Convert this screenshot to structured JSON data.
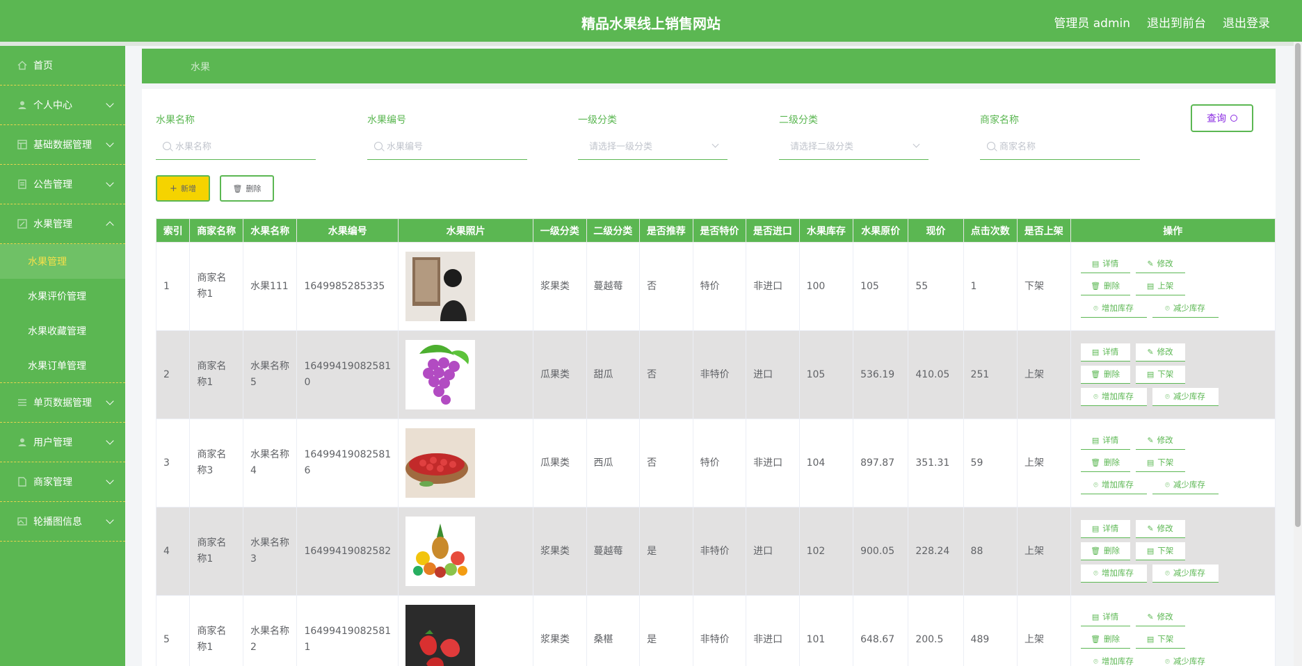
{
  "header": {
    "title": "精品水果线上销售网站",
    "admin_label": "管理员 admin",
    "to_front": "退出到前台",
    "logout": "退出登录"
  },
  "sidebar": {
    "items": [
      {
        "label": "首页",
        "icon": "home-icon"
      },
      {
        "label": "个人中心",
        "icon": "user-icon"
      },
      {
        "label": "基础数据管理",
        "icon": "grid-icon"
      },
      {
        "label": "公告管理",
        "icon": "notice-icon"
      },
      {
        "label": "水果管理",
        "icon": "fruit-icon"
      },
      {
        "label": "单页数据管理",
        "icon": "list-icon"
      },
      {
        "label": "用户管理",
        "icon": "user-icon"
      },
      {
        "label": "商家管理",
        "icon": "shop-icon"
      },
      {
        "label": "轮播图信息",
        "icon": "image-icon"
      }
    ],
    "sub_items": [
      "水果管理",
      "水果评价管理",
      "水果收藏管理",
      "水果订单管理"
    ]
  },
  "breadcrumb": "水果",
  "filters": {
    "name_label": "水果名称",
    "name_placeholder": "水果名称",
    "code_label": "水果编号",
    "code_placeholder": "水果编号",
    "cat1_label": "一级分类",
    "cat1_placeholder": "请选择一级分类",
    "cat2_label": "二级分类",
    "cat2_placeholder": "请选择二级分类",
    "shop_label": "商家名称",
    "shop_placeholder": "商家名称",
    "query_button": "查询"
  },
  "actions": {
    "add": "新增",
    "delete": "删除"
  },
  "table": {
    "headers": [
      "索引",
      "商家名称",
      "水果名称",
      "水果编号",
      "水果照片",
      "一级分类",
      "二级分类",
      "是否推荐",
      "是否特价",
      "是否进口",
      "水果库存",
      "水果原价",
      "现价",
      "点击次数",
      "是否上架",
      "操作"
    ],
    "op_labels": {
      "detail": "详情",
      "edit": "修改",
      "delete": "删除",
      "stock_add": "增加库存",
      "stock_sub": "减少库存"
    },
    "rows": [
      {
        "index": "1",
        "shop": "商家名称1",
        "name": "水果111",
        "code": "1649985285335",
        "photo": "photo-person",
        "cat1": "浆果类",
        "cat2": "蔓越莓",
        "recommend": "否",
        "special": "特价",
        "imported": "非进口",
        "stock": "100",
        "orig_price": "105",
        "price": "55",
        "clicks": "1",
        "on_shelf": "下架",
        "toggle": "上架"
      },
      {
        "index": "2",
        "shop": "商家名称1",
        "name": "水果名称5",
        "code": "16499419082581 0",
        "photo": "photo-grapes",
        "cat1": "瓜果类",
        "cat2": "甜瓜",
        "recommend": "否",
        "special": "非特价",
        "imported": "进口",
        "stock": "105",
        "orig_price": "536.19",
        "price": "410.05",
        "clicks": "251",
        "on_shelf": "上架",
        "toggle": "下架"
      },
      {
        "index": "3",
        "shop": "商家名称3",
        "name": "水果名称4",
        "code": "16499419082581 6",
        "photo": "photo-berries",
        "cat1": "瓜果类",
        "cat2": "西瓜",
        "recommend": "否",
        "special": "特价",
        "imported": "非进口",
        "stock": "104",
        "orig_price": "897.87",
        "price": "351.31",
        "clicks": "59",
        "on_shelf": "上架",
        "toggle": "下架"
      },
      {
        "index": "4",
        "shop": "商家名称1",
        "name": "水果名称3",
        "code": "16499419082582",
        "photo": "photo-mixed",
        "cat1": "浆果类",
        "cat2": "蔓越莓",
        "recommend": "是",
        "special": "非特价",
        "imported": "进口",
        "stock": "102",
        "orig_price": "900.05",
        "price": "228.24",
        "clicks": "88",
        "on_shelf": "上架",
        "toggle": "下架"
      },
      {
        "index": "5",
        "shop": "商家名称1",
        "name": "水果名称2",
        "code": "16499419082581 1",
        "photo": "photo-strawberry",
        "cat1": "浆果类",
        "cat2": "桑椹",
        "recommend": "是",
        "special": "非特价",
        "imported": "非进口",
        "stock": "101",
        "orig_price": "648.67",
        "price": "200.5",
        "clicks": "489",
        "on_shelf": "上架",
        "toggle": "下架"
      }
    ]
  },
  "colors": {
    "primary": "#5bb752",
    "accent": "#f5d300",
    "row_alt": "#e2e1e1"
  }
}
